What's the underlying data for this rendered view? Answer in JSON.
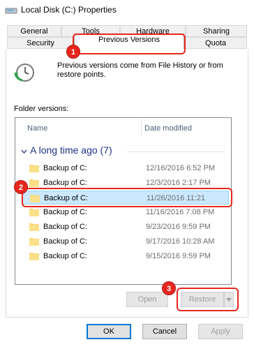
{
  "window": {
    "title": "Local Disk (C:) Properties"
  },
  "tabs_row1": [
    "General",
    "Tools",
    "Hardware",
    "Sharing"
  ],
  "tabs_row2": [
    "Security",
    "Previous Versions",
    "Quota"
  ],
  "info_text": "Previous versions come from File History or from restore points.",
  "folder_versions_label": "Folder versions:",
  "columns": {
    "name": "Name",
    "date": "Date modified"
  },
  "group": {
    "label": "A long time ago (7)"
  },
  "rows": [
    {
      "name": "Backup of C:",
      "date": "12/16/2016 6:52 PM"
    },
    {
      "name": "Backup of C:",
      "date": "12/3/2016 2:17 PM"
    },
    {
      "name": "Backup of C:",
      "date": "11/26/2016 11:21"
    },
    {
      "name": "Backup of C:",
      "date": "11/16/2016 7:08 PM"
    },
    {
      "name": "Backup of C:",
      "date": "9/23/2016 9:59 PM"
    },
    {
      "name": "Backup of C:",
      "date": "9/17/2016 10:28 AM"
    },
    {
      "name": "Backup of C:",
      "date": "9/15/2016 9:59 PM"
    }
  ],
  "buttons": {
    "open": "Open",
    "restore": "Restore",
    "ok": "OK",
    "cancel": "Cancel",
    "apply": "Apply"
  },
  "markers": [
    "1",
    "2",
    "3"
  ],
  "colors": {
    "accent": "#0078d7",
    "selection": "#cce8ff",
    "annotation": "#e8261d",
    "group_text": "#1e3287"
  }
}
